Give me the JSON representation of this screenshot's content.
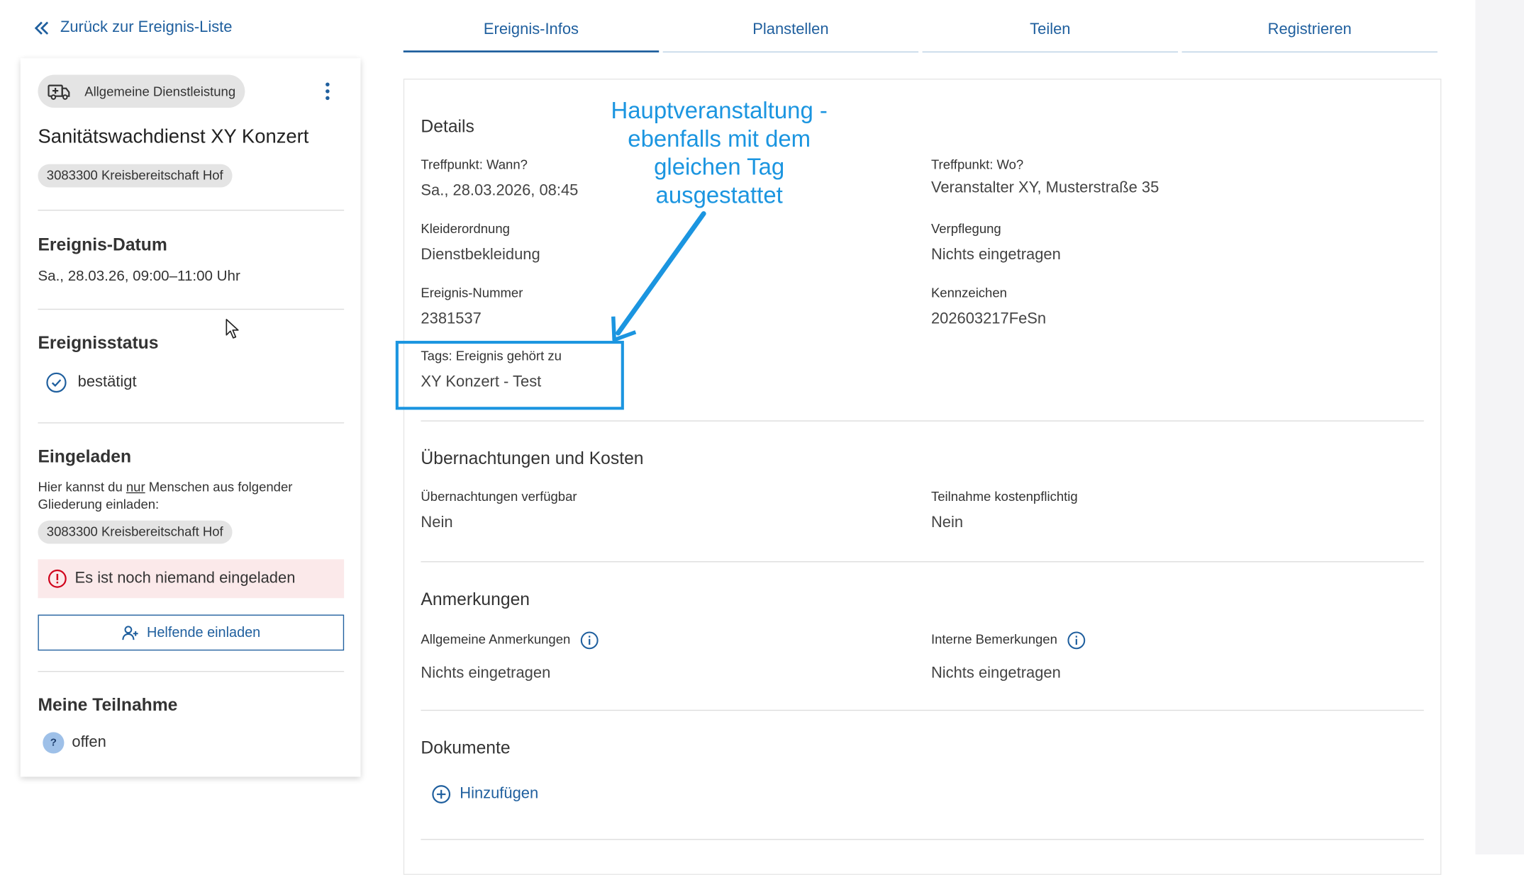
{
  "back_link": "Zurück zur Ereignis-Liste",
  "tabs": [
    "Ereignis-Infos",
    "Planstellen",
    "Teilen",
    "Registrieren"
  ],
  "sidebar": {
    "type_chip": "Allgemeine Dienstleistung",
    "title": "Sanitätswachdienst XY Konzert",
    "org_chip": "3083300 Kreisbereitschaft Hof",
    "date_heading": "Ereignis-Datum",
    "date_value": "Sa., 28.03.26, 09:00–11:00 Uhr",
    "status_heading": "Ereignisstatus",
    "status_value": "bestätigt",
    "invited_heading": "Eingeladen",
    "invite_text_before": "Hier kannst du ",
    "invite_text_underlined": "nur",
    "invite_text_after": " Menschen aus folgender Gliederung einladen:",
    "invite_org_chip": "3083300 Kreisbereitschaft Hof",
    "alert": "Es ist noch niemand eingeladen",
    "invite_button": "Helfende einladen",
    "participation_heading": "Meine Teilnahme",
    "participation_badge": "?",
    "participation_value": "offen"
  },
  "details": {
    "heading": "Details",
    "meeting_when_label": "Treffpunkt: Wann?",
    "meeting_when_value": "Sa., 28.03.2026, 08:45",
    "meeting_where_label": "Treffpunkt: Wo?",
    "meeting_where_value": "Veranstalter XY, Musterstraße 35",
    "dress_label": "Kleiderordnung",
    "dress_value": "Dienstbekleidung",
    "catering_label": "Verpflegung",
    "catering_value": "Nichts eingetragen",
    "number_label": "Ereignis-Nummer",
    "number_value": "2381537",
    "code_label": "Kennzeichen",
    "code_value": "202603217FeSn",
    "tags_label": "Tags: Ereignis gehört zu",
    "tags_value": "XY Konzert - Test"
  },
  "overnight": {
    "heading": "Übernachtungen und Kosten",
    "overnight_label": "Übernachtungen verfügbar",
    "overnight_value": "Nein",
    "cost_label": "Teilnahme kostenpflichtig",
    "cost_value": "Nein"
  },
  "remarks": {
    "heading": "Anmerkungen",
    "general_label": "Allgemeine Anmerkungen",
    "general_value": "Nichts eingetragen",
    "internal_label": "Interne Bemerkungen",
    "internal_value": "Nichts eingetragen"
  },
  "documents": {
    "heading": "Dokumente",
    "add_label": "Hinzufügen"
  },
  "annotation": {
    "line1": "Hauptveranstaltung -",
    "line2": "ebenfalls mit dem",
    "line3": "gleichen Tag",
    "line4": "ausgestattet"
  },
  "colors": {
    "primary": "#1f5f9e",
    "annotation": "#1b95e0",
    "alert_bg": "#fbe9ea",
    "alert_icon": "#d0021b",
    "chip_bg": "#e4e4e4"
  }
}
